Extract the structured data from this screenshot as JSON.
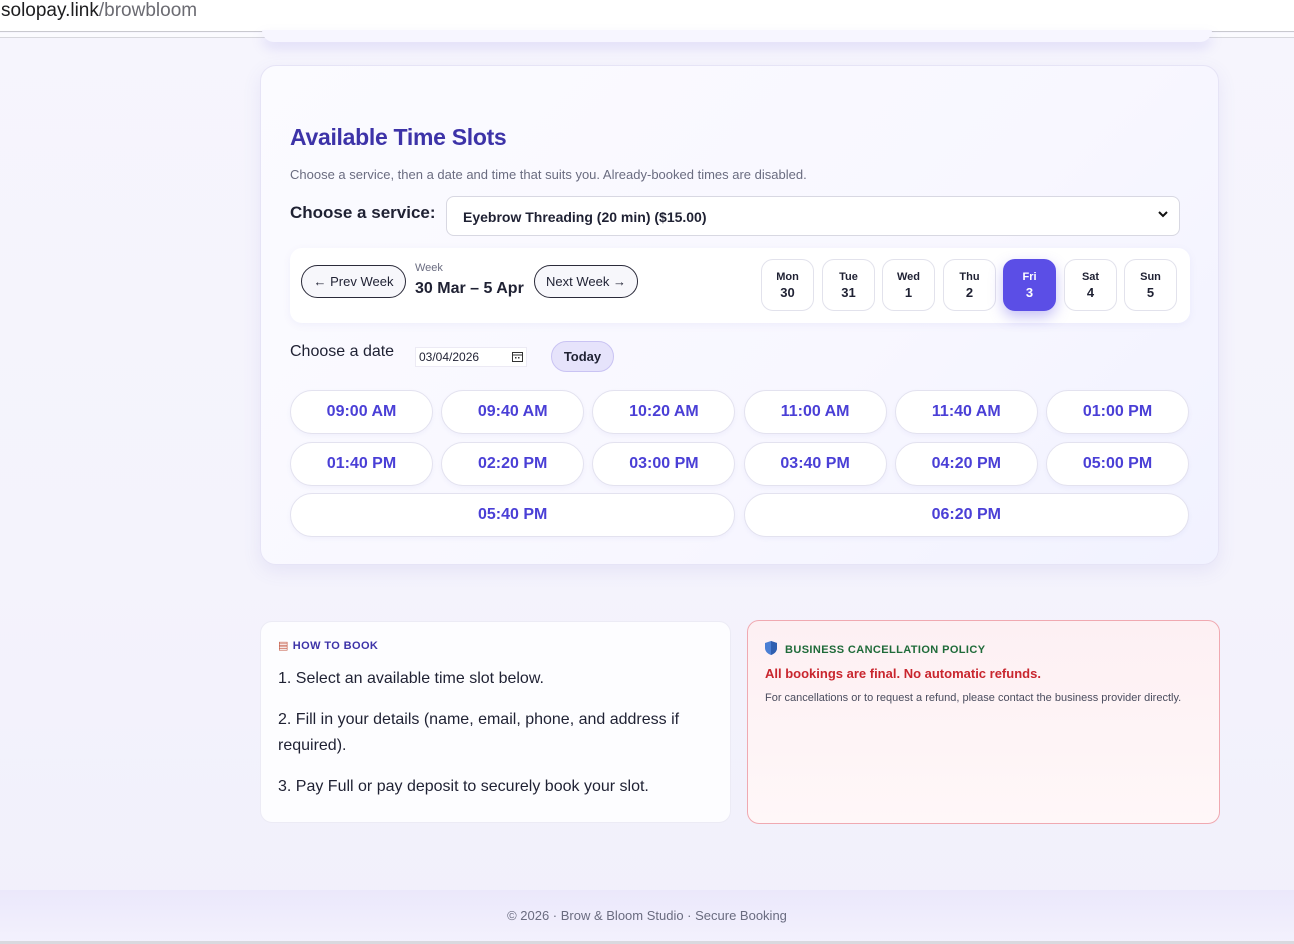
{
  "browser": {
    "url_host": "solopay.link",
    "url_path": "/browbloom"
  },
  "slots_section": {
    "title": "Available Time Slots",
    "subtitle": "Choose a service, then a date and time that suits you. Already-booked times are disabled.",
    "service_label": "Choose a service:",
    "service_selected": "Eyebrow Threading (20 min) ($15.00)",
    "week": {
      "prev_label": "← Prev Week",
      "next_label": "Next Week →",
      "caption": "Week",
      "range": "30 Mar – 5 Apr",
      "days": [
        {
          "name": "Mon",
          "num": "30",
          "active": false
        },
        {
          "name": "Tue",
          "num": "31",
          "active": false
        },
        {
          "name": "Wed",
          "num": "1",
          "active": false
        },
        {
          "name": "Thu",
          "num": "2",
          "active": false
        },
        {
          "name": "Fri",
          "num": "3",
          "active": true
        },
        {
          "name": "Sat",
          "num": "4",
          "active": false
        },
        {
          "name": "Sun",
          "num": "5",
          "active": false
        }
      ]
    },
    "date_label": "Choose a date",
    "date_value": "03/04/2026",
    "today_label": "Today",
    "slots": [
      "09:00 AM",
      "09:40 AM",
      "10:20 AM",
      "11:00 AM",
      "11:40 AM",
      "01:00 PM",
      "01:40 PM",
      "02:20 PM",
      "03:00 PM",
      "03:40 PM",
      "04:20 PM",
      "05:00 PM",
      "05:40 PM",
      "06:20 PM"
    ]
  },
  "how_to_book": {
    "icon": "clipboard-icon",
    "title": "HOW TO BOOK",
    "steps": [
      "1. Select an available time slot below.",
      "2. Fill in your details (name, email, phone, and address if required).",
      "3. Pay Full or pay deposit to securely book your slot."
    ]
  },
  "policy": {
    "icon": "shield-icon",
    "title": "BUSINESS CANCELLATION POLICY",
    "alert": "All bookings are final. No automatic refunds.",
    "text": "For cancellations or to request a refund, please contact the business provider directly."
  },
  "footer": {
    "text": "© 2026 · Brow & Bloom Studio · Secure Booking"
  },
  "colors": {
    "accent": "#5b4ee6",
    "title": "#3d33a8",
    "alert": "#c9262e",
    "policy_title": "#1f6b3a"
  }
}
